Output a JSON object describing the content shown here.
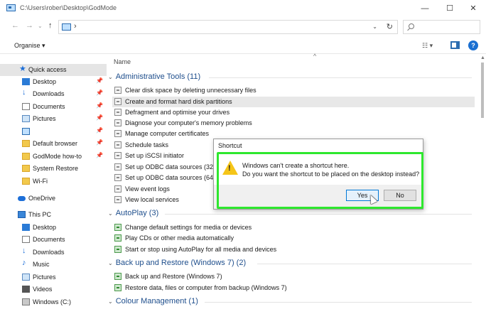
{
  "window": {
    "title": "C:\\Users\\rober\\Desktop\\GodMode",
    "minimize_glyph": "—",
    "maximize_glyph": "☐",
    "close_glyph": "✕"
  },
  "address": {
    "back_glyph": "←",
    "forward_glyph": "→",
    "dropdown_glyph": "⌄",
    "up_glyph": "↑",
    "separator": "›",
    "addr_dropdown_glyph": "⌄",
    "refresh_glyph": "↻",
    "search_placeholder": ""
  },
  "ribbon": {
    "organise_label": "Organise ▾",
    "view_glyph": "☷ ▾",
    "help_label": "?"
  },
  "sidebar": {
    "quick_access": "Quick access",
    "items": [
      {
        "label": "Desktop",
        "icon": "desktop-icon",
        "pinned": true
      },
      {
        "label": "Downloads",
        "icon": "downloads-icon",
        "pinned": true
      },
      {
        "label": "Documents",
        "icon": "documents-icon",
        "pinned": true
      },
      {
        "label": "Pictures",
        "icon": "pictures-icon",
        "pinned": true
      },
      {
        "label": "",
        "icon": "godmode-icon",
        "pinned": true
      },
      {
        "label": "Default browser",
        "icon": "folder-icon",
        "pinned": true
      },
      {
        "label": "GodMode how-to",
        "icon": "folder-icon",
        "pinned": true
      },
      {
        "label": "System Restore",
        "icon": "folder-icon",
        "pinned": false
      },
      {
        "label": "Wi-Fi",
        "icon": "folder-icon",
        "pinned": false
      }
    ],
    "onedrive": "OneDrive",
    "this_pc": "This PC",
    "pc_items": [
      {
        "label": "Desktop",
        "icon": "desktop-icon"
      },
      {
        "label": "Documents",
        "icon": "documents-icon"
      },
      {
        "label": "Downloads",
        "icon": "downloads-icon"
      },
      {
        "label": "Music",
        "icon": "music-icon"
      },
      {
        "label": "Pictures",
        "icon": "pictures-icon"
      },
      {
        "label": "Videos",
        "icon": "videos-icon"
      },
      {
        "label": "Windows (C:)",
        "icon": "drive-icon"
      }
    ],
    "pin_glyph": "📌"
  },
  "content": {
    "column_name": "Name",
    "sort_glyph": "^",
    "groups": [
      {
        "title": "Administrative Tools (11)",
        "items": [
          "Clear disk space by deleting unnecessary files",
          "Create and format hard disk partitions",
          "Defragment and optimise your drives",
          "Diagnose your computer's memory problems",
          "Manage computer certificates",
          "Schedule tasks",
          "Set up iSCSI initiator",
          "Set up ODBC data sources (32-bi",
          "Set up ODBC data sources (64-bi",
          "View event logs",
          "View local services"
        ]
      },
      {
        "title": "AutoPlay (3)",
        "items": [
          "Change default settings for media or devices",
          "Play CDs or other media automatically",
          "Start or stop using AutoPlay for all media and devices"
        ]
      },
      {
        "title": "Back up and Restore (Windows 7) (2)",
        "items": [
          "Back up and Restore (Windows 7)",
          "Restore data, files or computer from backup (Windows 7)"
        ]
      },
      {
        "title": "Colour Management (1)",
        "items": []
      }
    ],
    "group_chevron": "⌄",
    "scroll_up_glyph": "▲"
  },
  "dialog": {
    "title": "Shortcut",
    "line1": "Windows can't create a shortcut here.",
    "line2": "Do you want the shortcut to be placed on the desktop instead?",
    "warn_mark": "!",
    "yes_label": "Yes",
    "no_label": "No"
  },
  "colors": {
    "highlight": "#2ee82e",
    "group_header": "#1e4e8c",
    "accent": "#0078d7"
  }
}
